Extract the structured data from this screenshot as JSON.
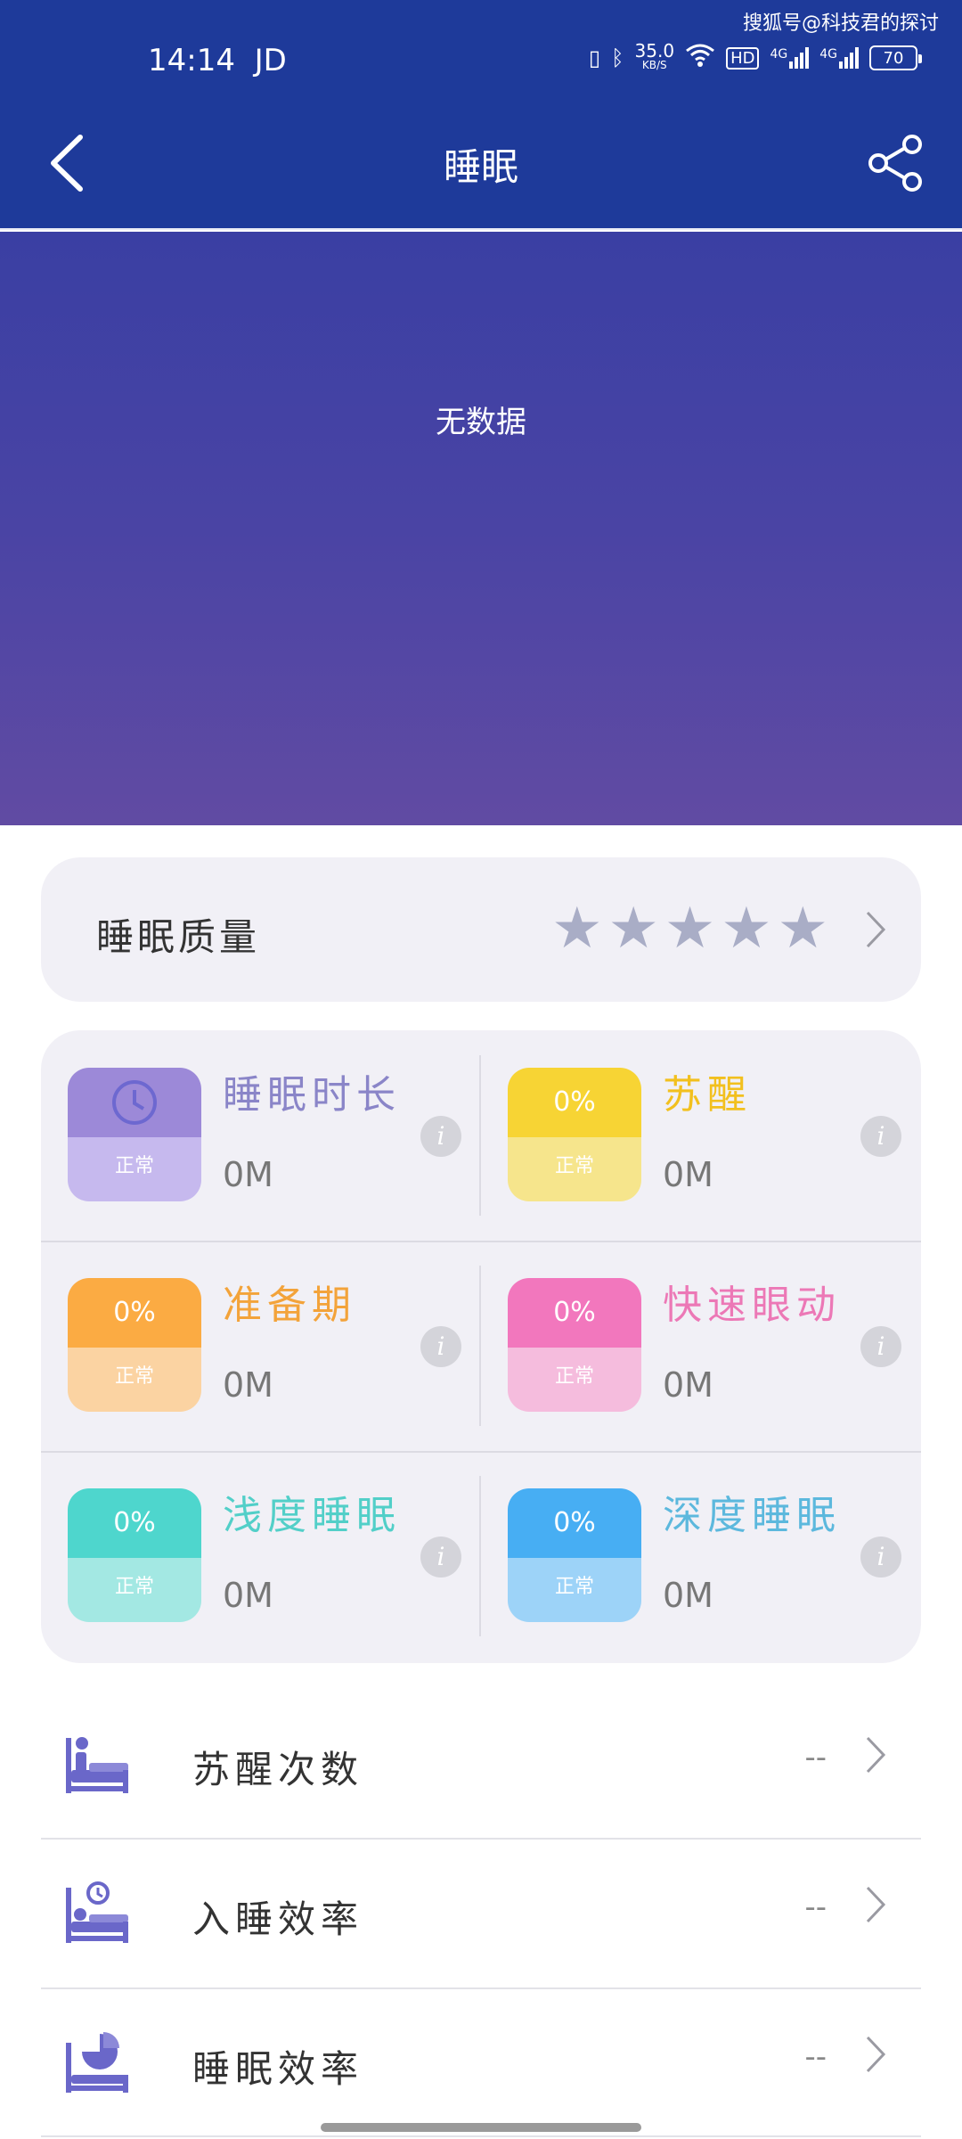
{
  "watermark": "搜狐号@科技君的探讨",
  "status": {
    "time": "14:14",
    "carrier": "JD",
    "speed": "35.0",
    "speed_unit": "KB/S",
    "hd": "HD",
    "net1": "4G",
    "net2": "4G",
    "battery": "70"
  },
  "nav": {
    "title": "睡眠"
  },
  "chart": {
    "empty_text": "无数据"
  },
  "quality": {
    "label": "睡眠质量",
    "rating": 0,
    "max_rating": 5
  },
  "stats": [
    {
      "title": "睡眠时长",
      "value": "0M",
      "badge_top": "",
      "badge_bottom": "正常",
      "icon": "clock-icon",
      "title_color": "#8a85c8",
      "top_color": "#9c89d8",
      "bottom_color": "#c6b9ee"
    },
    {
      "title": "苏醒",
      "value": "0M",
      "badge_top": "0%",
      "badge_bottom": "正常",
      "title_color": "#f2c01e",
      "top_color": "#f7d434",
      "bottom_color": "#f6e58c"
    },
    {
      "title": "准备期",
      "value": "0M",
      "badge_top": "0%",
      "badge_bottom": "正常",
      "title_color": "#f3a33a",
      "top_color": "#fbab43",
      "bottom_color": "#fbd3a2"
    },
    {
      "title": "快速眼动",
      "value": "0M",
      "badge_top": "0%",
      "badge_bottom": "正常",
      "title_color": "#ec78b6",
      "top_color": "#f277bd",
      "bottom_color": "#f5bcdd"
    },
    {
      "title": "浅度睡眠",
      "value": "0M",
      "badge_top": "0%",
      "badge_bottom": "正常",
      "title_color": "#52cfc8",
      "top_color": "#4ed6cd",
      "bottom_color": "#a3e8e3"
    },
    {
      "title": "深度睡眠",
      "value": "0M",
      "badge_top": "0%",
      "badge_bottom": "正常",
      "title_color": "#5cb8dd",
      "top_color": "#47aef3",
      "bottom_color": "#9dd3f8"
    }
  ],
  "info_glyph": "i",
  "list": [
    {
      "label": "苏醒次数",
      "value": "--",
      "icon": "bed-person-up-icon"
    },
    {
      "label": "入睡效率",
      "value": "--",
      "icon": "bed-clock-icon"
    },
    {
      "label": "睡眠效率",
      "value": "--",
      "icon": "bed-pie-icon"
    }
  ],
  "colors": {
    "header": "#1e3a9a",
    "accent_icon": "#6a67c9",
    "card_bg": "#f1f0f6"
  }
}
